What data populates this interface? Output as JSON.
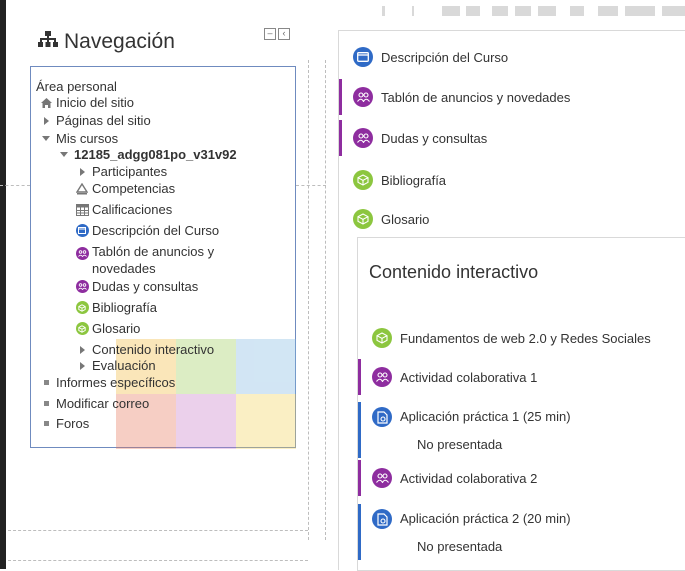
{
  "navigation": {
    "title": "Navegación",
    "items": [
      {
        "label": "Área personal"
      },
      {
        "label": "Inicio del sitio"
      },
      {
        "label": "Páginas del sitio"
      },
      {
        "label": "Mis cursos"
      },
      {
        "label": "12185_adgg081po_v31v92"
      },
      {
        "label": "Participantes"
      },
      {
        "label": "Competencias"
      },
      {
        "label": "Calificaciones"
      },
      {
        "label": "Descripción del Curso"
      },
      {
        "label": "Tablón de anuncios y novedades"
      },
      {
        "label": "Dudas y consultas"
      },
      {
        "label": "Bibliografía"
      },
      {
        "label": "Glosario"
      },
      {
        "label": "Contenido interactivo"
      },
      {
        "label": "Evaluación"
      },
      {
        "label": "Informes específicos"
      },
      {
        "label": "Modificar correo"
      },
      {
        "label": "Foros"
      }
    ],
    "tablon_line1": "Tablón de anuncios y",
    "tablon_line2": "novedades"
  },
  "course": {
    "activities": [
      {
        "label": "Descripción del Curso"
      },
      {
        "label": "Tablón de anuncios y novedades"
      },
      {
        "label": "Dudas y consultas"
      },
      {
        "label": "Bibliografía"
      },
      {
        "label": "Glosario"
      }
    ],
    "section": {
      "title": "Contenido interactivo",
      "activities": [
        {
          "label": "Fundamentos de web 2.0 y Redes Sociales"
        },
        {
          "label": "Actividad colaborativa 1"
        },
        {
          "label": "Aplicación práctica 1 (25 min)",
          "status": "No presentada"
        },
        {
          "label": "Actividad colaborativa 2"
        },
        {
          "label": "Aplicación práctica 2 (20 min)",
          "status": "No presentada"
        }
      ]
    }
  },
  "colors": {
    "page_blue": "#2f6ac6",
    "forum_purple": "#8e2d9f",
    "book_green": "#8cc63f"
  }
}
